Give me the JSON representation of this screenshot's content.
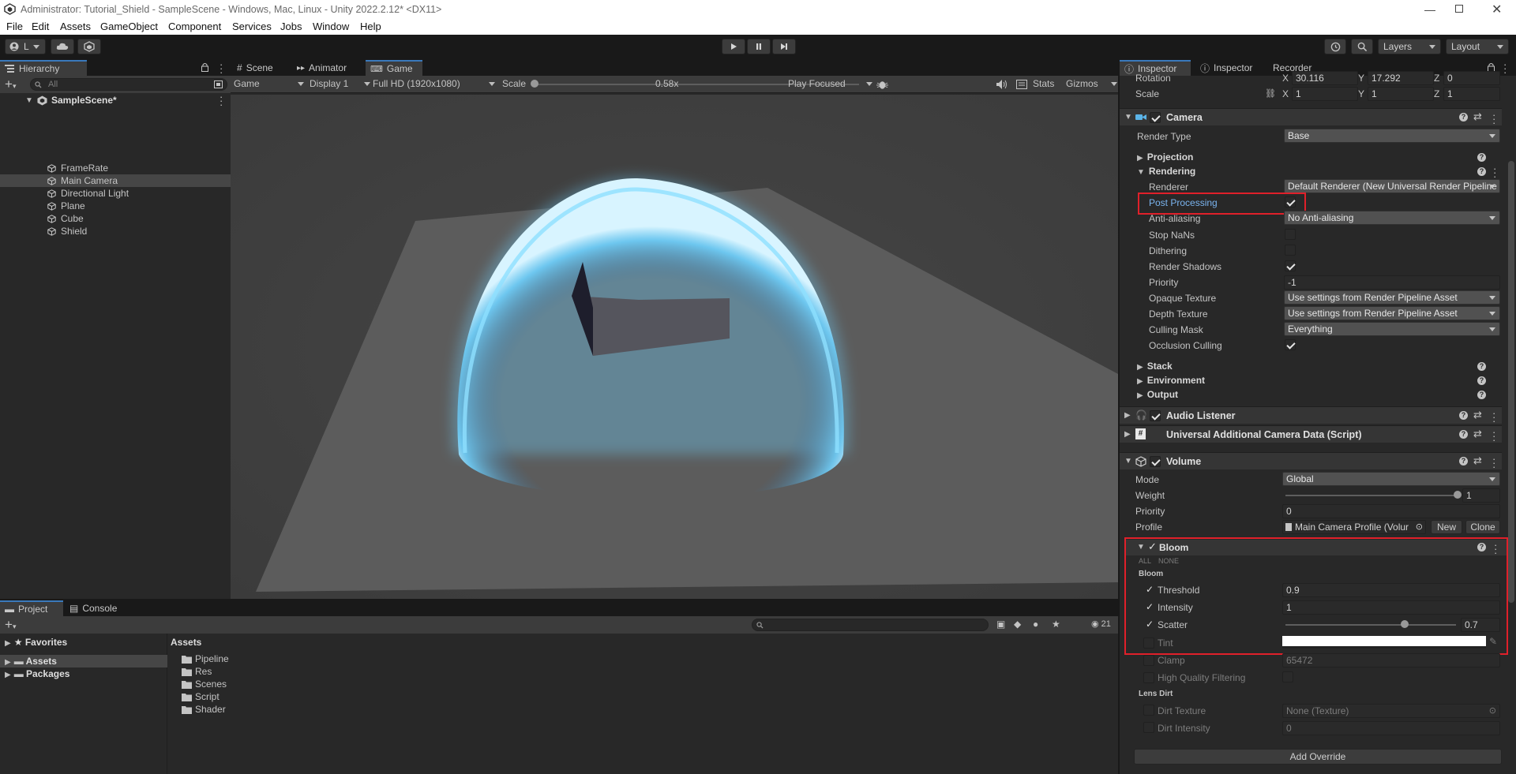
{
  "window": {
    "title": "Administrator: Tutorial_Shield - SampleScene - Windows, Mac, Linux - Unity 2022.2.12* <DX11>"
  },
  "menu": [
    "File",
    "Edit",
    "Assets",
    "GameObject",
    "Component",
    "Services",
    "Jobs",
    "Window",
    "Help"
  ],
  "toolbar": {
    "account": "L",
    "layers": "Layers",
    "layout": "Layout"
  },
  "hierarchy": {
    "tab": "Hierarchy",
    "search_placeholder": "All",
    "scene": "SampleScene*",
    "items": [
      "FrameRate",
      "Main Camera",
      "Directional Light",
      "Plane",
      "Cube",
      "Shield"
    ],
    "selected": "Main Camera"
  },
  "game_view": {
    "tabs": [
      "Scene",
      "Animator",
      "Game"
    ],
    "active_tab": "Game",
    "mode": "Game",
    "display": "Display 1",
    "resolution": "Full HD (1920x1080)",
    "scale_label": "Scale",
    "scale_value": "0.58x",
    "play_focus": "Play Focused",
    "stats": "Stats",
    "gizmos": "Gizmos"
  },
  "project": {
    "tabs": [
      "Project",
      "Console"
    ],
    "favorites": "Favorites",
    "assets": "Assets",
    "packages": "Packages",
    "folder_title": "Assets",
    "folders": [
      "Pipeline",
      "Res",
      "Scenes",
      "Script",
      "Shader"
    ],
    "count": "21"
  },
  "inspector": {
    "tabs": [
      "Inspector",
      "Inspector",
      "Recorder"
    ],
    "transform": {
      "rotation_label": "Rotation",
      "rotation": {
        "x": "30.116",
        "y": "17.292",
        "z": "0"
      },
      "scale_label": "Scale",
      "scale": {
        "x": "1",
        "y": "1",
        "z": "1"
      }
    },
    "camera": {
      "title": "Camera",
      "render_type_label": "Render Type",
      "render_type": "Base",
      "projection": "Projection",
      "rendering": "Rendering",
      "renderer_label": "Renderer",
      "renderer": "Default Renderer (New Universal Render Pipeline",
      "post_processing_label": "Post Processing",
      "post_processing": true,
      "anti_aliasing_label": "Anti-aliasing",
      "anti_aliasing": "No Anti-aliasing",
      "stop_nans_label": "Stop NaNs",
      "stop_nans": false,
      "dithering_label": "Dithering",
      "dithering": false,
      "render_shadows_label": "Render Shadows",
      "render_shadows": true,
      "priority_label": "Priority",
      "priority": "-1",
      "opaque_texture_label": "Opaque Texture",
      "opaque_texture": "Use settings from Render Pipeline Asset",
      "depth_texture_label": "Depth Texture",
      "depth_texture": "Use settings from Render Pipeline Asset",
      "culling_mask_label": "Culling Mask",
      "culling_mask": "Everything",
      "occlusion_culling_label": "Occlusion Culling",
      "occlusion_culling": true,
      "stack": "Stack",
      "environment": "Environment",
      "output": "Output"
    },
    "audio_listener": "Audio Listener",
    "uacd": "Universal Additional Camera Data (Script)",
    "volume": {
      "title": "Volume",
      "mode_label": "Mode",
      "mode": "Global",
      "weight_label": "Weight",
      "weight": "1",
      "weight_fraction": 1.0,
      "priority_label": "Priority",
      "priority": "0",
      "profile_label": "Profile",
      "profile": "Main Camera Profile (Volur",
      "new_btn": "New",
      "clone_btn": "Clone"
    },
    "bloom": {
      "title": "Bloom",
      "all": "ALL",
      "none": "NONE",
      "section": "Bloom",
      "threshold_label": "Threshold",
      "threshold": "0.9",
      "intensity_label": "Intensity",
      "intensity": "1",
      "scatter_label": "Scatter",
      "scatter": "0.7",
      "scatter_fraction": 0.7,
      "tint_label": "Tint",
      "clamp_label": "Clamp",
      "clamp": "65472",
      "hq_label": "High Quality Filtering",
      "lens_dirt": "Lens Dirt",
      "dirt_texture_label": "Dirt Texture",
      "dirt_texture": "None (Texture)",
      "dirt_intensity_label": "Dirt Intensity",
      "dirt_intensity": "0"
    },
    "add_override": "Add Override"
  },
  "colors": {
    "accent": "#3a79bb",
    "highlight_box": "#e0202a",
    "panel": "#282828",
    "shield_glow": "#6fd2ff"
  }
}
